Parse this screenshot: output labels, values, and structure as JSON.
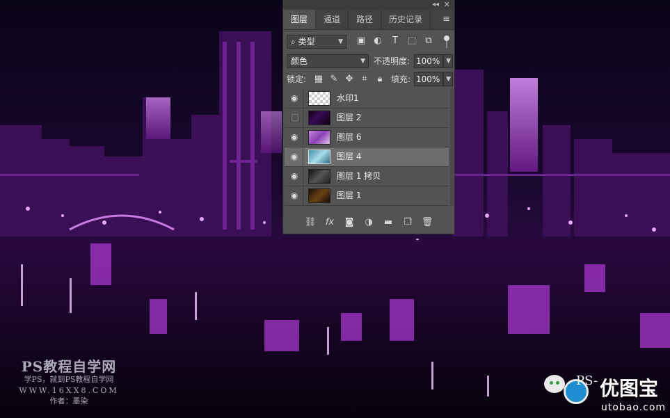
{
  "panel": {
    "tabs": [
      "图层",
      "通道",
      "路径",
      "历史记录"
    ],
    "active_tab": "图层",
    "filter_kind": "类型",
    "blend_mode": "颜色",
    "opacity_label": "不透明度:",
    "opacity_value": "100%",
    "lock_label": "锁定:",
    "fill_label": "填充:",
    "fill_value": "100%",
    "layers": [
      {
        "name": "水印1",
        "visible": true,
        "selected": false
      },
      {
        "name": "图层 2",
        "visible": false,
        "selected": false
      },
      {
        "name": "图层 6",
        "visible": true,
        "selected": false
      },
      {
        "name": "图层 4",
        "visible": true,
        "selected": true
      },
      {
        "name": "图层 1 拷贝",
        "visible": true,
        "selected": false
      },
      {
        "name": "图层 1",
        "visible": true,
        "selected": false
      }
    ]
  },
  "watermark_left": {
    "line1": "PS教程自学网",
    "line2": "学PS，就到PS教程自学网",
    "line3": "WWW.16XX8.COM",
    "line4": "作者：墨染"
  },
  "watermark_right": {
    "ps": "PS-",
    "brand": "优图宝",
    "url": "utobao.com"
  },
  "colors": {
    "panel_bg": "#535353",
    "selected_layer": "#6d6d6d",
    "city_glow": "#b03ad8"
  }
}
